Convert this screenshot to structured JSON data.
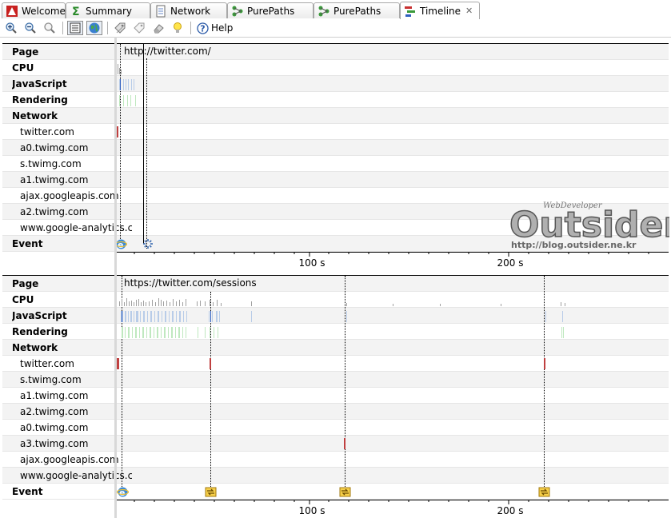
{
  "tabs": [
    {
      "id": "welcome",
      "label": "Welcome",
      "icon": "welcome-icon",
      "active": false
    },
    {
      "id": "summary",
      "label": "Summary",
      "icon": "sigma-icon",
      "active": false
    },
    {
      "id": "network",
      "label": "Network",
      "icon": "document-icon",
      "active": false
    },
    {
      "id": "purepaths1",
      "label": "PurePaths",
      "icon": "purepath-icon",
      "active": false
    },
    {
      "id": "purepaths2",
      "label": "PurePaths",
      "icon": "purepath-icon",
      "active": false
    },
    {
      "id": "timeline",
      "label": "Timeline",
      "icon": "timeline-icon",
      "active": true,
      "closable": true
    }
  ],
  "toolbar": {
    "buttons": [
      {
        "name": "zoom-in-icon"
      },
      {
        "name": "zoom-out-icon"
      },
      {
        "name": "zoom-reset-icon"
      },
      {
        "name": "list-view-icon",
        "pressed": true
      },
      {
        "name": "globe-icon",
        "pressed": true
      },
      {
        "name": "tag-icon"
      },
      {
        "name": "tag-outline-icon"
      },
      {
        "name": "eraser-icon"
      },
      {
        "name": "lightbulb-icon"
      }
    ],
    "help_label": "Help"
  },
  "panels": [
    {
      "url": "http://twitter.com/",
      "axis_ticks": [
        "100 s",
        "200 s"
      ],
      "rows": [
        {
          "label": "Page",
          "bold": true
        },
        {
          "label": "CPU",
          "bold": true
        },
        {
          "label": "JavaScript",
          "bold": true
        },
        {
          "label": "Rendering",
          "bold": true
        },
        {
          "label": "Network",
          "bold": true
        },
        {
          "label": "twitter.com",
          "bold": false
        },
        {
          "label": "a0.twimg.com",
          "bold": false
        },
        {
          "label": "s.twimg.com",
          "bold": false
        },
        {
          "label": "a1.twimg.com",
          "bold": false
        },
        {
          "label": "ajax.googleapis.com",
          "bold": false
        },
        {
          "label": "a2.twimg.com",
          "bold": false
        },
        {
          "label": "www.google-analytics.com",
          "bold": false
        },
        {
          "label": "Event",
          "bold": true
        }
      ]
    },
    {
      "url": "https://twitter.com/sessions",
      "axis_ticks": [
        "100 s",
        "200 s"
      ],
      "rows": [
        {
          "label": "Page",
          "bold": true
        },
        {
          "label": "CPU",
          "bold": true
        },
        {
          "label": "JavaScript",
          "bold": true
        },
        {
          "label": "Rendering",
          "bold": true
        },
        {
          "label": "Network",
          "bold": true
        },
        {
          "label": "twitter.com",
          "bold": false
        },
        {
          "label": "s.twimg.com",
          "bold": false
        },
        {
          "label": "a1.twimg.com",
          "bold": false
        },
        {
          "label": "a2.twimg.com",
          "bold": false
        },
        {
          "label": "a0.twimg.com",
          "bold": false
        },
        {
          "label": "a3.twimg.com",
          "bold": false
        },
        {
          "label": "ajax.googleapis.com",
          "bold": false
        },
        {
          "label": "www.google-analytics.com",
          "bold": false
        },
        {
          "label": "Event",
          "bold": true
        }
      ]
    }
  ],
  "watermark": {
    "top_text": "WebDeveloper",
    "main_text": "Outsider",
    "url_text": "http://blog.outsider.ne.kr"
  },
  "colors": {
    "javascript": "#b8cce8",
    "rendering": "#bfe8bf",
    "cpu": "#a0a0a0",
    "network": "#c04040",
    "event": "#f0c030"
  }
}
